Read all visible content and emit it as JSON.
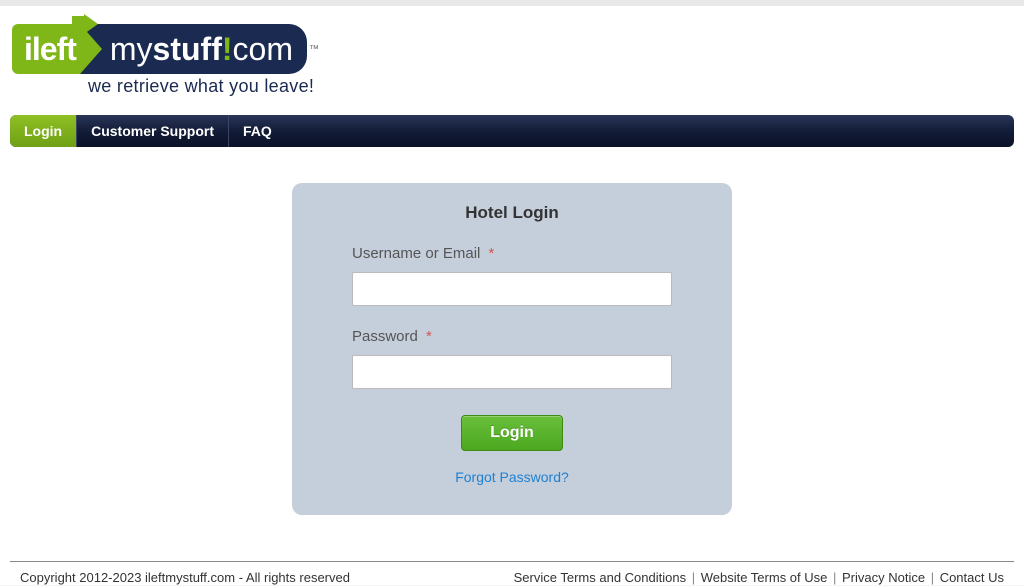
{
  "logo": {
    "part1": "ileft",
    "part2_my": "my",
    "part2_stuff": "stuff",
    "part2_bang": "!",
    "part2_com": "com",
    "tm": "™",
    "tagline": "we retrieve what you leave!"
  },
  "nav": {
    "items": [
      {
        "label": "Login",
        "active": true
      },
      {
        "label": "Customer Support",
        "active": false
      },
      {
        "label": "FAQ",
        "active": false
      }
    ]
  },
  "login": {
    "title": "Hotel Login",
    "username_label": "Username or Email",
    "password_label": "Password",
    "required_mark": "*",
    "button_label": "Login",
    "forgot_label": "Forgot Password?"
  },
  "footer": {
    "copyright": "Copyright 2012-2023 ileftmystuff.com - All rights reserved",
    "links": [
      "Service Terms and Conditions",
      "Website Terms of Use",
      "Privacy Notice",
      "Contact Us"
    ],
    "sep": " | "
  }
}
